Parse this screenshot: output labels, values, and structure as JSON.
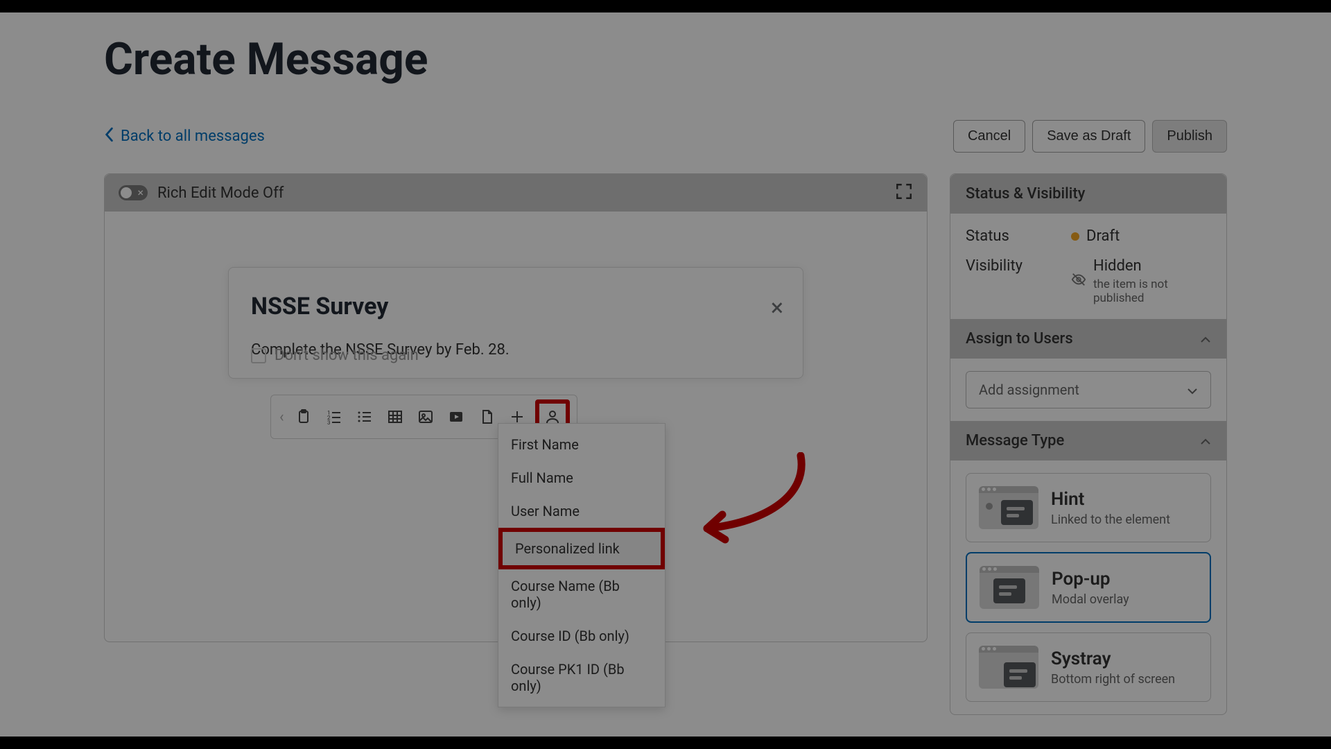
{
  "page": {
    "title": "Create Message"
  },
  "back_link": "Back to all messages",
  "actions": {
    "cancel": "Cancel",
    "save_draft": "Save as Draft",
    "publish": "Publish"
  },
  "editor": {
    "mode_label": "Rich Edit Mode Off",
    "card_title": "NSSE Survey",
    "card_body": "Complete the NSSE Survey by Feb. 28.",
    "dont_show": "Don't show this again"
  },
  "dropdown": {
    "items": [
      "First Name",
      "Full Name",
      "User Name",
      "Personalized link",
      "Course Name (Bb only)",
      "Course ID (Bb only)",
      "Course PK1 ID (Bb only)"
    ],
    "highlight_index": 3
  },
  "sidebar": {
    "status_header": "Status & Visibility",
    "status": {
      "label": "Status",
      "value": "Draft"
    },
    "visibility": {
      "label": "Visibility",
      "value": "Hidden",
      "sub": "the item is not published"
    },
    "assign_header": "Assign to Users",
    "assign_placeholder": "Add assignment",
    "mtype_header": "Message Type",
    "types": [
      {
        "name": "Hint",
        "desc": "Linked to the element",
        "kind": "hint",
        "selected": false
      },
      {
        "name": "Pop-up",
        "desc": "Modal overlay",
        "kind": "popup",
        "selected": true
      },
      {
        "name": "Systray",
        "desc": "Bottom right of screen",
        "kind": "systray",
        "selected": false
      }
    ]
  }
}
